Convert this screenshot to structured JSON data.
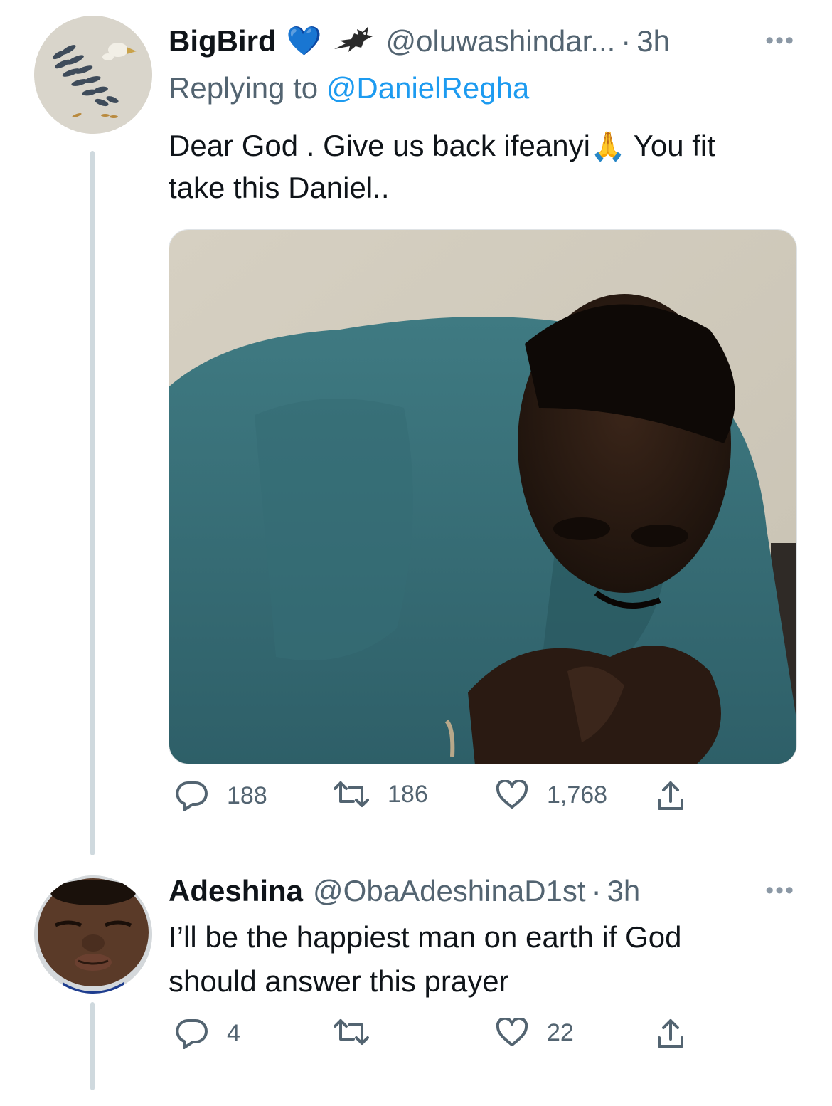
{
  "tweets": [
    {
      "name": "BigBird",
      "name_emoji": "💙",
      "handle": "@oluwashindar...",
      "separator": "·",
      "time": "3h",
      "replying_prefix": "Replying to",
      "replying_to": "@DanielRegha",
      "text_line1_a": "Dear God . Give us back ifeanyi",
      "text_emoji": "🙏",
      "text_line1_b": "You fit",
      "text_line2": "take this Daniel..",
      "stats": {
        "replies": "188",
        "retweets": "186",
        "likes": "1,768"
      }
    },
    {
      "name": "Adeshina",
      "handle": "@ObaAdeshinaD1st",
      "separator": "·",
      "time": "3h",
      "text_line1": "I’ll be the happiest man on earth if God",
      "text_line2": "should answer this prayer",
      "stats": {
        "replies": "4",
        "retweets": "",
        "likes": "22"
      }
    }
  ],
  "colors": {
    "text_primary": "#0f1419",
    "text_secondary": "#536471",
    "link": "#1d9bf0",
    "thread_line": "#cfd9de"
  }
}
